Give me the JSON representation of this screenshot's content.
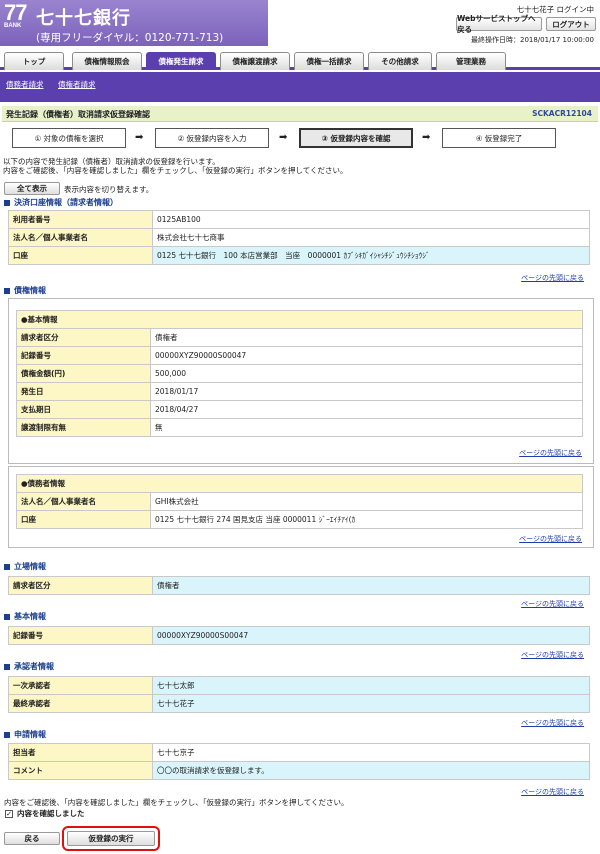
{
  "header": {
    "logo_number": "77",
    "logo_bank": "BANK",
    "bank_name": "七十七銀行",
    "tel": "(専用フリーダイヤル：0120-771-713)",
    "user": "七十七花子 ログイン中",
    "web_service_top": "Webサービストップへ戻る",
    "logout": "ログアウト",
    "last_operation": "最終操作日時：2018/01/17 10:00:00"
  },
  "tabs": [
    {
      "label": "トップ",
      "active": false
    },
    {
      "label": "債権情報照会",
      "active": false
    },
    {
      "label": "債権発生請求",
      "active": true
    },
    {
      "label": "債権譲渡請求",
      "active": false
    },
    {
      "label": "債権一括請求",
      "active": false
    },
    {
      "label": "その他請求",
      "active": false
    },
    {
      "label": "管理業務",
      "active": false
    }
  ],
  "subnav": [
    "債務者請求",
    "債権者請求"
  ],
  "page": {
    "title": "発生記録（債権者）取消請求仮登録確認",
    "code": "SCKACR12104"
  },
  "steps": [
    {
      "label": "① 対象の債権を選択",
      "active": false
    },
    {
      "label": "② 仮登録内容を入力",
      "active": false
    },
    {
      "label": "③ 仮登録内容を確認",
      "active": true
    },
    {
      "label": "④ 仮登録完了",
      "active": false
    }
  ],
  "intro": {
    "line1": "以下の内容で発生記録（債権者）取消請求の仮登録を行います。",
    "line2": "内容をご確認後、「内容を確認しました」欄をチェックし、「仮登録の実行」ボタンを押してください。"
  },
  "show_all_button": "全て表示",
  "show_all_note": "表示内容を切り替えます。",
  "page_top_link": "ページの先頭に戻る",
  "settlement": {
    "heading": "決済口座情報（請求者情報）",
    "rows": [
      {
        "k": "利用者番号",
        "v": "0125AB100"
      },
      {
        "k": "法人名／個人事業者名",
        "v": "株式会社七十七商事"
      },
      {
        "k": "口座",
        "v": "0125 七十七銀行　100 本店営業部　当座　0000001 ｶﾌﾞｼｷｶﾞｲｼｬｼﾁｼﾞｭｳｼﾁｼｮｳｼﾞ"
      }
    ]
  },
  "claim": {
    "heading": "債権情報",
    "basic_title": "●基本情報",
    "basic_rows": [
      {
        "k": "請求者区分",
        "v": "債権者"
      },
      {
        "k": "記録番号",
        "v": "00000XYZ90000S00047"
      },
      {
        "k": "債権金額(円)",
        "v": "500,000"
      },
      {
        "k": "発生日",
        "v": "2018/01/17"
      },
      {
        "k": "支払期日",
        "v": "2018/04/27"
      },
      {
        "k": "譲渡制限有無",
        "v": "無"
      }
    ],
    "debtor_title": "●債務者情報",
    "debtor_rows": [
      {
        "k": "法人名／個人事業者名",
        "v": "GHI株式会社"
      },
      {
        "k": "口座",
        "v": "0125 七十七銀行 274 国見支店 当座 0000011 ｼﾞｰｴｲﾁｱｲ(ｶ"
      }
    ]
  },
  "position": {
    "heading": "立場情報",
    "rows": [
      {
        "k": "請求者区分",
        "v": "債権者"
      }
    ]
  },
  "basic": {
    "heading": "基本情報",
    "rows": [
      {
        "k": "記録番号",
        "v": "00000XYZ90000S00047"
      }
    ]
  },
  "approver": {
    "heading": "承認者情報",
    "rows": [
      {
        "k": "一次承認者",
        "v": "七十七太郎"
      },
      {
        "k": "最終承認者",
        "v": "七十七花子"
      }
    ]
  },
  "request": {
    "heading": "申請情報",
    "rows": [
      {
        "k": "担当者",
        "v": "七十七京子"
      },
      {
        "k": "コメント",
        "v": "〇〇の取消請求を仮登録します。"
      }
    ]
  },
  "footer": {
    "instruction": "内容をご確認後、「内容を確認しました」欄をチェックし、「仮登録の実行」ボタンを押してください。",
    "confirm_label": "内容を確認しました",
    "confirm_checked": "✓",
    "back_button": "戻る",
    "execute_button": "仮登録の実行"
  }
}
